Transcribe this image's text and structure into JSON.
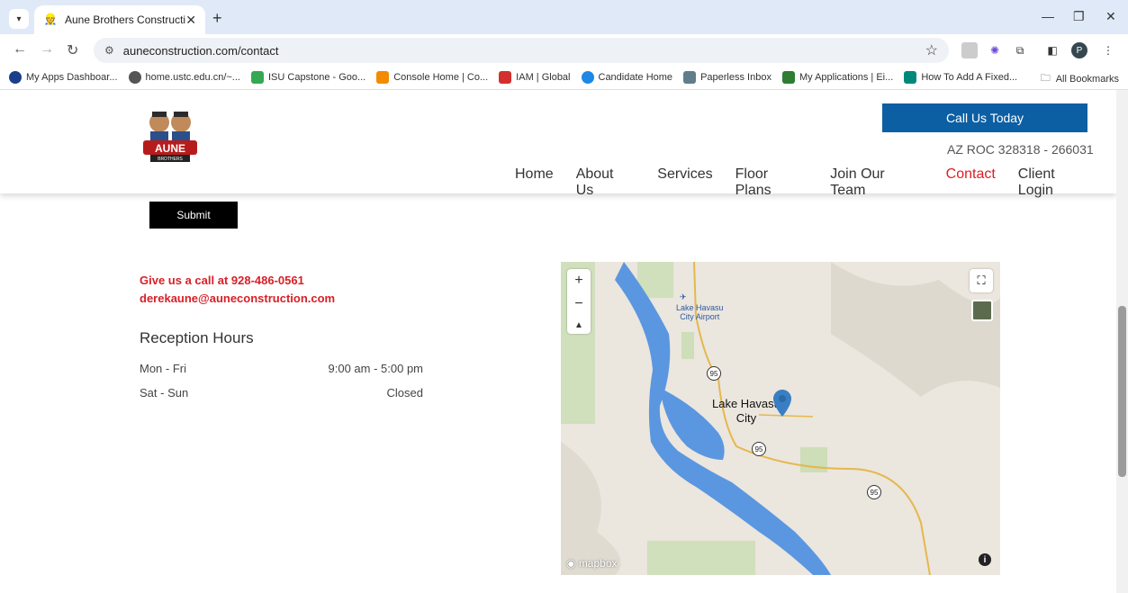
{
  "browser": {
    "tab_title": "Aune Brothers Construction",
    "tab_close": "✕",
    "newtab": "+",
    "url": "auneconstruction.com/contact",
    "bookmarks": [
      {
        "label": "My Apps Dashboar...",
        "color": "#1a3f8a"
      },
      {
        "label": "home.ustc.edu.cn/~...",
        "color": "#555555"
      },
      {
        "label": "ISU Capstone - Goo...",
        "color": "#34a853"
      },
      {
        "label": "Console Home | Co...",
        "color": "#f28b00"
      },
      {
        "label": "IAM | Global",
        "color": "#d32f2f"
      },
      {
        "label": "Candidate Home",
        "color": "#1e88e5"
      },
      {
        "label": "Paperless Inbox",
        "color": "#607d8b"
      },
      {
        "label": "My Applications | Ei...",
        "color": "#2e7d32"
      },
      {
        "label": "How To Add A Fixed...",
        "color": "#00897b"
      }
    ],
    "all_bookmarks": "All Bookmarks",
    "profile_initial": "P"
  },
  "header": {
    "logo_text": "AUNE",
    "logo_subtext": "BROTHERS",
    "call_button": "Call Us Today",
    "license": "AZ ROC 328318 - 266031",
    "nav": [
      "Home",
      "About Us",
      "Services",
      "Floor Plans",
      "Join Our Team",
      "Contact",
      "Client Login"
    ]
  },
  "form": {
    "submit_label": "Submit"
  },
  "contact": {
    "call_text": "Give us a call at 928-486-0561",
    "email": "derekaune@auneconstruction.com",
    "hours_title": "Reception Hours",
    "hours": [
      {
        "days": "Mon - Fri",
        "time": "9:00 am - 5:00 pm"
      },
      {
        "days": "Sat - Sun",
        "time": "Closed"
      }
    ]
  },
  "map": {
    "airport_label_1": "Lake Havasu",
    "airport_label_2": "City Airport",
    "city_label_1": "Lake Havasu",
    "city_label_2": "City",
    "highway": "95",
    "attribution": "mapbox",
    "info": "i"
  }
}
